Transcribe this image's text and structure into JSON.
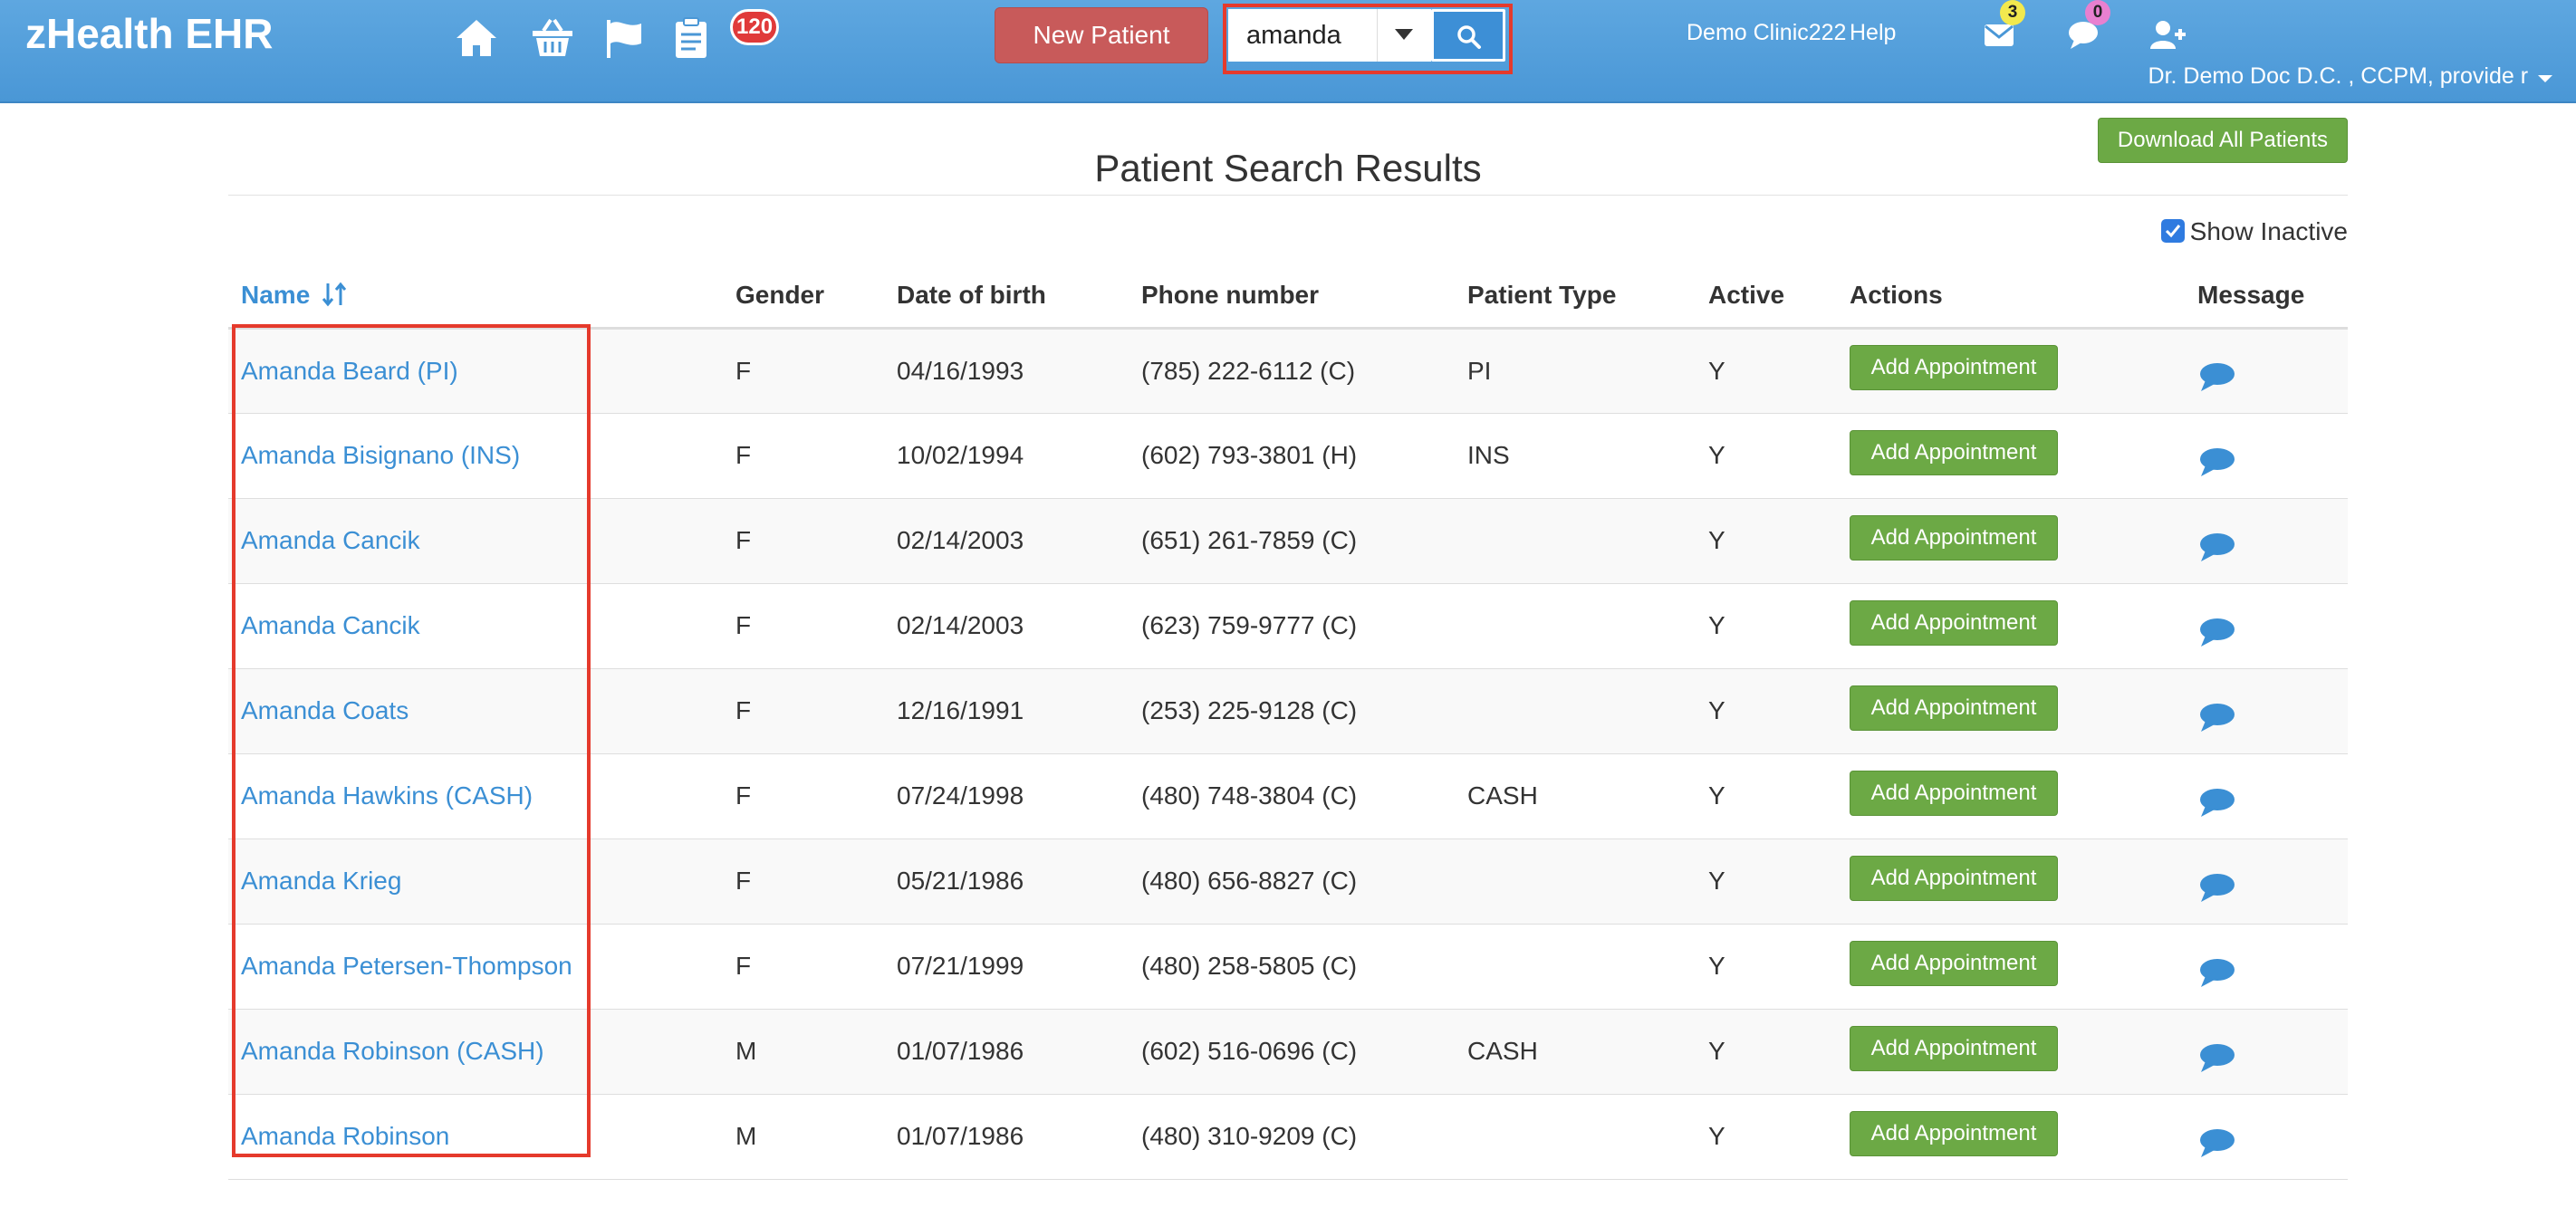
{
  "app": {
    "brand": "zHealth EHR",
    "accent_color": "#4a97d6"
  },
  "nav": {
    "icons": [
      "home-icon",
      "basket-icon",
      "flag-icon",
      "clipboard-icon"
    ],
    "tasks_badge": "120"
  },
  "toolbar": {
    "new_patient_label": "New Patient",
    "search_value": "amanda",
    "search_icon": "search-icon"
  },
  "header": {
    "clinic": "Demo Clinic222",
    "help": "Help",
    "mail_count": "3",
    "chat_count": "0",
    "user": "Dr. Demo Doc D.C. , CCPM, provide r"
  },
  "main": {
    "title": "Patient Search Results",
    "download_label": "Download All Patients",
    "show_inactive_label": "Show Inactive",
    "show_inactive_checked": true,
    "columns": [
      "Name",
      "Gender",
      "Date of birth",
      "Phone number",
      "Patient Type",
      "Active",
      "Actions",
      "Message"
    ],
    "action_label": "Add Appointment",
    "rows": [
      {
        "name": "Amanda Beard  (PI)",
        "gender": "F",
        "dob": "04/16/1993",
        "phone": "(785) 222-6112 (C)",
        "type": "PI",
        "active": "Y"
      },
      {
        "name": "Amanda Bisignano  (INS)",
        "gender": "F",
        "dob": "10/02/1994",
        "phone": "(602) 793-3801 (H)",
        "type": "INS",
        "active": "Y"
      },
      {
        "name": "Amanda Cancik",
        "gender": "F",
        "dob": "02/14/2003",
        "phone": "(651) 261-7859 (C)",
        "type": "",
        "active": "Y"
      },
      {
        "name": "Amanda Cancik",
        "gender": "F",
        "dob": "02/14/2003",
        "phone": "(623) 759-9777 (C)",
        "type": "",
        "active": "Y"
      },
      {
        "name": "Amanda Coats",
        "gender": "F",
        "dob": "12/16/1991",
        "phone": "(253) 225-9128 (C)",
        "type": "",
        "active": "Y"
      },
      {
        "name": "Amanda Hawkins  (CASH)",
        "gender": "F",
        "dob": "07/24/1998",
        "phone": "(480) 748-3804 (C)",
        "type": "CASH",
        "active": "Y"
      },
      {
        "name": "Amanda Krieg",
        "gender": "F",
        "dob": "05/21/1986",
        "phone": "(480) 656-8827 (C)",
        "type": "",
        "active": "Y"
      },
      {
        "name": "Amanda Petersen-Thompson",
        "gender": "F",
        "dob": "07/21/1999",
        "phone": "(480) 258-5805 (C)",
        "type": "",
        "active": "Y"
      },
      {
        "name": "Amanda Robinson  (CASH)",
        "gender": "M",
        "dob": "01/07/1986",
        "phone": "(602) 516-0696 (C)",
        "type": "CASH",
        "active": "Y"
      },
      {
        "name": "Amanda Robinson",
        "gender": "M",
        "dob": "01/07/1986",
        "phone": "(480) 310-9209 (C)",
        "type": "",
        "active": "Y"
      }
    ]
  }
}
